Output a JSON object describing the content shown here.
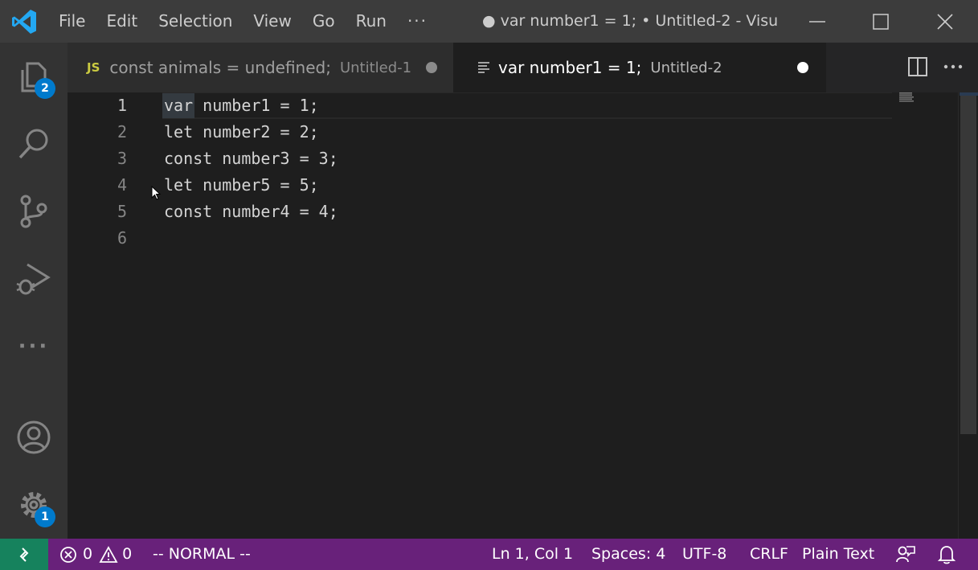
{
  "titlebar": {
    "menu": [
      "File",
      "Edit",
      "Selection",
      "View",
      "Go",
      "Run"
    ],
    "more": "···",
    "window_title": "● var number1 = 1; • Untitled-2 - Visu..."
  },
  "activitybar": {
    "explorer_badge": "2",
    "settings_badge": "1",
    "more": "···"
  },
  "tabs": [
    {
      "icon": "JS",
      "title": "const animals = undefined;",
      "description": "Untitled-1",
      "dirty": true,
      "active": false
    },
    {
      "icon": "text-file-icon",
      "title": "var number1 = 1;",
      "description": "Untitled-2",
      "dirty": true,
      "active": true
    }
  ],
  "editor": {
    "line_numbers": [
      "1",
      "2",
      "3",
      "4",
      "5",
      "6"
    ],
    "lines": [
      "var number1 = 1;",
      "let number2 = 2;",
      "const number3 = 3;",
      "let number5 = 5;",
      "const number4 = 4;",
      ""
    ],
    "current_line": 1
  },
  "statusbar": {
    "errors": "0",
    "warnings": "0",
    "mode": "-- NORMAL --",
    "position": "Ln 1, Col 1",
    "indent": "Spaces: 4",
    "encoding": "UTF-8",
    "eol": "CRLF",
    "language": "Plain Text"
  },
  "colors": {
    "statusbar": "#68217a",
    "remote": "#16825d",
    "badge": "#007acc",
    "activitybar": "#333333",
    "titlebar": "#3c3c3c",
    "editor": "#1e1e1e"
  }
}
